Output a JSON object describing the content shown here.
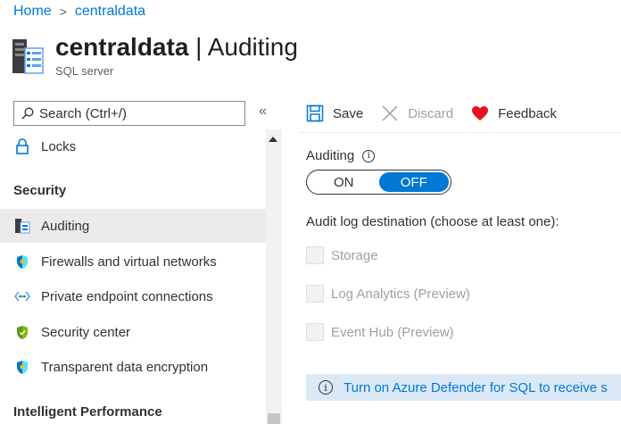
{
  "breadcrumb": {
    "home": "Home",
    "separator": ">",
    "current": "centraldata"
  },
  "header": {
    "resource_name": "centraldata",
    "divider": " | ",
    "blade_title": "Auditing",
    "subtitle": "SQL server",
    "icon": "sql-server-icon"
  },
  "search": {
    "placeholder": "Search (Ctrl+/)",
    "icon": "search-icon"
  },
  "collapse_label": "«",
  "sidebar": {
    "items": [
      {
        "label": "Locks",
        "icon": "lock-icon"
      },
      {
        "label": "Auditing",
        "icon": "auditing-icon",
        "active": true
      },
      {
        "label": "Firewalls and virtual networks",
        "icon": "shield-icon"
      },
      {
        "label": "Private endpoint connections",
        "icon": "endpoint-icon"
      },
      {
        "label": "Security center",
        "icon": "security-center-icon"
      },
      {
        "label": "Transparent data encryption",
        "icon": "encryption-shield-icon"
      }
    ],
    "sections": {
      "security": "Security",
      "intelligent_performance": "Intelligent Performance"
    }
  },
  "toolbar": {
    "save": "Save",
    "discard": "Discard",
    "feedback": "Feedback"
  },
  "main": {
    "auditing_label": "Auditing",
    "toggle": {
      "on": "ON",
      "off": "OFF",
      "selected": "OFF"
    },
    "destination_label": "Audit log destination (choose at least one):",
    "destinations": [
      "Storage",
      "Log Analytics (Preview)",
      "Event Hub (Preview)"
    ],
    "info_bar": "Turn on Azure Defender for SQL to receive s"
  },
  "colors": {
    "accent": "#0078d4",
    "feedback_heart": "#e81123",
    "info_bar_bg": "#dbe9f7",
    "active_nav": "#edebe9"
  }
}
